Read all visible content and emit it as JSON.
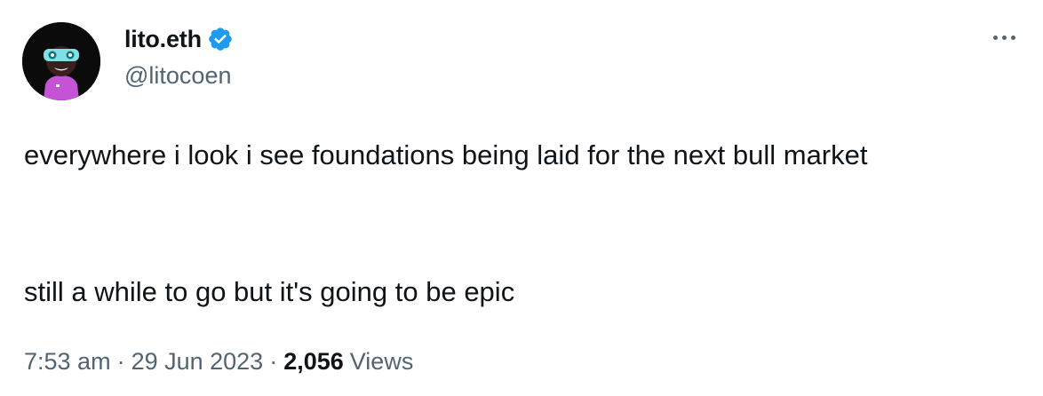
{
  "author": {
    "display_name": "lito.eth",
    "handle": "@litocoen",
    "verified": true,
    "verified_color": "#1d9bf0"
  },
  "tweet": {
    "line1": "everywhere i look i see foundations being laid for the next bull market",
    "line2": "still a while to go but it's going to be epic"
  },
  "meta": {
    "time": "7:53 am",
    "separator": "·",
    "date": "29 Jun 2023",
    "views_count": "2,056",
    "views_label": "Views"
  },
  "icons": {
    "more": "more-options-icon",
    "verified": "verified-badge-icon"
  }
}
